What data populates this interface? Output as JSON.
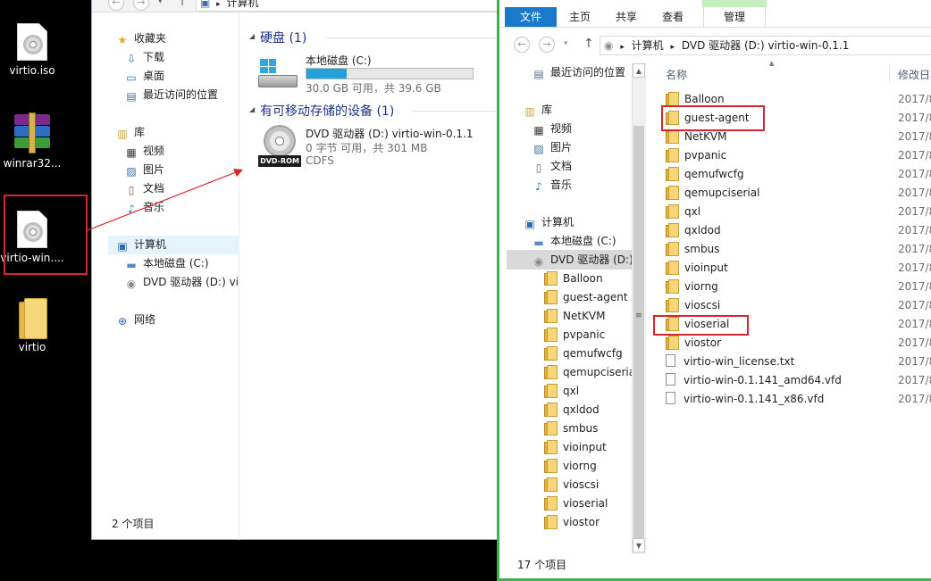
{
  "desktop": {
    "icons": [
      {
        "label": "virtio.iso",
        "icon": "disc-image-icon"
      },
      {
        "label": "winrar32...",
        "icon": "winrar-icon"
      },
      {
        "label": "virtio-win....",
        "icon": "disc-image-icon"
      },
      {
        "label": "virtio",
        "icon": "folder-icon"
      }
    ]
  },
  "left_window": {
    "address": {
      "path": "计算机"
    },
    "nav": {
      "favorites": "收藏夹",
      "downloads": "下载",
      "desktop": "桌面",
      "recent": "最近访问的位置",
      "library": "库",
      "videos": "视频",
      "pictures": "图片",
      "documents": "文档",
      "music": "音乐",
      "computer": "计算机",
      "local_disk": "本地磁盘 (C:)",
      "dvd_drive": "DVD 驱动器 (D:) vir",
      "network": "网络"
    },
    "groups": {
      "hard_disks": "硬盘 (1)",
      "removable": "有可移动存储的设备 (1)"
    },
    "drives": {
      "c_name": "本地磁盘 (C:)",
      "c_free": "30.0 GB 可用，共 39.6 GB",
      "c_used_fraction": 0.24,
      "d_name": "DVD 驱动器 (D:) virtio-win-0.1.1",
      "d_free": "0 字节 可用，共 301 MB",
      "d_fs": "CDFS",
      "d_badge": "DVD-ROM"
    },
    "status": "2 个项目"
  },
  "right_window": {
    "ribbon": {
      "file": "文件",
      "home": "主页",
      "share": "共享",
      "view": "查看",
      "manage": "管理"
    },
    "address": {
      "seg1": "计算机",
      "seg2": "DVD 驱动器 (D:) virtio-win-0.1.1"
    },
    "nav": {
      "recent": "最近访问的位置",
      "library": "库",
      "videos": "视频",
      "pictures": "图片",
      "documents": "文档",
      "music": "音乐",
      "computer": "计算机",
      "local_disk": "本地磁盘 (C:)",
      "dvd_drive": "DVD 驱动器 (D:)",
      "dvd_children": [
        "Balloon",
        "guest-agent",
        "NetKVM",
        "pvpanic",
        "qemufwcfg",
        "qemupciserial",
        "qxl",
        "qxldod",
        "smbus",
        "vioinput",
        "viorng",
        "vioscsi",
        "vioserial",
        "viostor"
      ]
    },
    "columns": {
      "name": "名称",
      "modified": "修改日期"
    },
    "files": [
      {
        "name": "Balloon",
        "type": "folder",
        "date": "2017/8"
      },
      {
        "name": "guest-agent",
        "type": "folder",
        "date": "2017/8"
      },
      {
        "name": "NetKVM",
        "type": "folder",
        "date": "2017/8"
      },
      {
        "name": "pvpanic",
        "type": "folder",
        "date": "2017/8"
      },
      {
        "name": "qemufwcfg",
        "type": "folder",
        "date": "2017/8"
      },
      {
        "name": "qemupciserial",
        "type": "folder",
        "date": "2017/8"
      },
      {
        "name": "qxl",
        "type": "folder",
        "date": "2017/8"
      },
      {
        "name": "qxldod",
        "type": "folder",
        "date": "2017/8"
      },
      {
        "name": "smbus",
        "type": "folder",
        "date": "2017/8"
      },
      {
        "name": "vioinput",
        "type": "folder",
        "date": "2017/8"
      },
      {
        "name": "viorng",
        "type": "folder",
        "date": "2017/8"
      },
      {
        "name": "vioscsi",
        "type": "folder",
        "date": "2017/8"
      },
      {
        "name": "vioserial",
        "type": "folder",
        "date": "2017/8"
      },
      {
        "name": "viostor",
        "type": "folder",
        "date": "2017/8"
      },
      {
        "name": "virtio-win_license.txt",
        "type": "file",
        "date": "2017/8"
      },
      {
        "name": "virtio-win-0.1.141_amd64.vfd",
        "type": "file",
        "date": "2017/8"
      },
      {
        "name": "virtio-win-0.1.141_x86.vfd",
        "type": "file",
        "date": "2017/8"
      }
    ],
    "status": "17 个项目"
  },
  "colors": {
    "annotation_red": "#d9262b",
    "ribbon_blue": "#1979ca",
    "window_border": "#3bb34a"
  }
}
